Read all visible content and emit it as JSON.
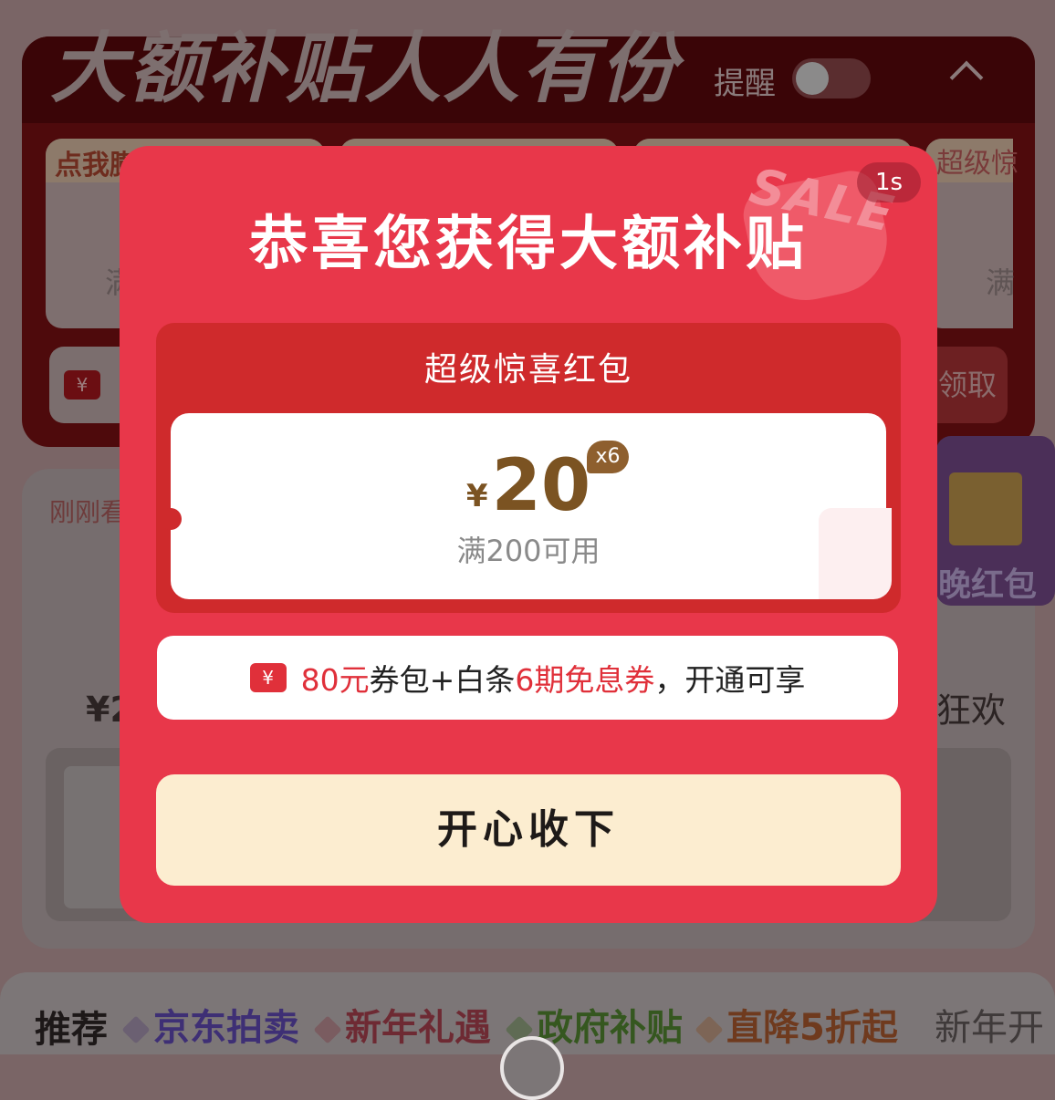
{
  "background": {
    "hero_title": "大额补贴人人有份",
    "remind_label": "提醒",
    "card_left_label": "点我膨胀",
    "card_right_label": "超级惊",
    "card_condition_prefix": "满",
    "claim_tail": "领取",
    "just_seen": "刚刚看",
    "price_prefix": "¥2",
    "gift_text": "晚红包",
    "carnival_text": "狂欢",
    "nav": {
      "recommend": "推荐",
      "items": [
        "京东拍卖",
        "新年礼遇",
        "政府补贴",
        "直降5折起",
        "新年开"
      ]
    }
  },
  "modal": {
    "timer": "1s",
    "deco_sale": "SALE",
    "title": "恭喜您获得大额补贴",
    "coupon": {
      "heading": "超级惊喜红包",
      "currency": "¥",
      "amount": "20",
      "multiplier": "x6",
      "condition": "满200可用"
    },
    "benefit": {
      "icon_text": "¥",
      "part1": "80元",
      "part2": "券包+白条",
      "part3": "6期免息券",
      "part4": "，开通可享"
    },
    "accept_button": "开心收下"
  },
  "colors": {
    "modal_bg": "#e8374a",
    "coupon_area": "#cf2a2c",
    "coupon_amount": "#7b5322",
    "accept_button_bg": "#fcedd0",
    "highlight_red": "#e0303a"
  }
}
